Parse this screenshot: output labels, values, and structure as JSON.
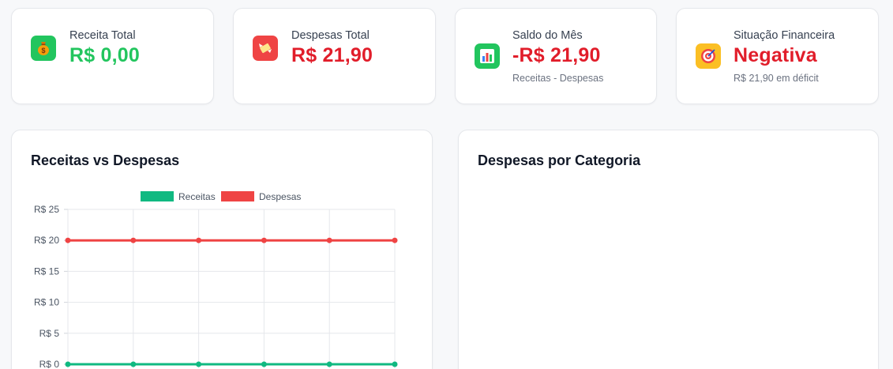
{
  "colors": {
    "income_green": "#22c55e",
    "expense_red": "#ef4444",
    "value_red": "#e11d2a",
    "warning_yellow": "#fbbf24"
  },
  "cards": [
    {
      "label": "Receita Total",
      "value": "R$ 0,00",
      "value_color": "#22c55e",
      "icon": "money-bag-icon",
      "icon_bg": "#22c55e"
    },
    {
      "label": "Despesas Total",
      "value": "R$ 21,90",
      "value_color": "#e11d2a",
      "icon": "money-with-wings-icon",
      "icon_bg": "#ef4444"
    },
    {
      "label": "Saldo do Mês",
      "value": "-R$ 21,90",
      "value_color": "#e11d2a",
      "subtitle": "Receitas - Despesas",
      "icon": "bar-chart-icon",
      "icon_bg": "#22c55e"
    },
    {
      "label": "Situação Financeira",
      "value": "Negativa",
      "value_color": "#e11d2a",
      "subtitle": "R$ 21,90 em déficit",
      "icon": "target-icon",
      "icon_bg": "#fbbf24"
    }
  ],
  "panels": {
    "income_vs_expenses": {
      "title": "Receitas vs Despesas"
    },
    "expenses_by_category": {
      "title": "Despesas por Categoria"
    }
  },
  "chart_data": {
    "type": "line",
    "x": [
      "",
      "",
      "",
      "",
      "",
      ""
    ],
    "series": [
      {
        "name": "Receitas",
        "color": "#10b981",
        "values": [
          0,
          0,
          0,
          0,
          0,
          0
        ]
      },
      {
        "name": "Despesas",
        "color": "#ef4444",
        "values": [
          20,
          20,
          20,
          20,
          20,
          20
        ]
      }
    ],
    "yticks": [
      "R$ 0",
      "R$ 5",
      "R$ 10",
      "R$ 15",
      "R$ 20",
      "R$ 25"
    ],
    "ylim": [
      0,
      25
    ],
    "legend": "top-center",
    "grid": true
  }
}
